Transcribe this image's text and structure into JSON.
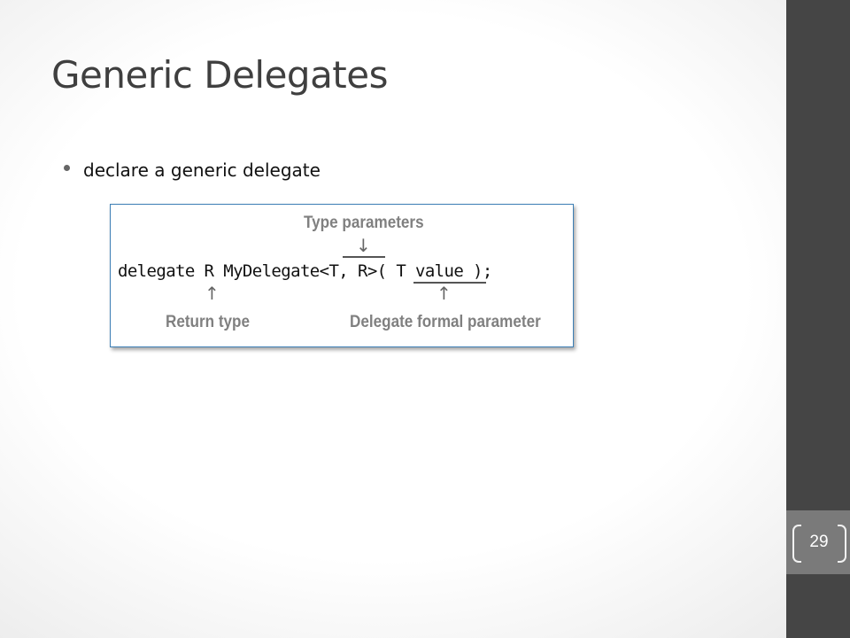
{
  "slide": {
    "title": "Generic Delegates",
    "bullets": [
      {
        "text": "declare a generic delegate"
      }
    ],
    "page_number": "29"
  },
  "figure": {
    "code": "delegate R MyDelegate<T, R>( T value );",
    "labels": {
      "type_parameters": "Type parameters",
      "return_type": "Return type",
      "formal_parameter": "Delegate formal parameter"
    },
    "arrow_down": "↓",
    "arrow_up": "↑"
  },
  "theme": {
    "sidebar_color": "#454545",
    "page_box_color": "#7a7a7a",
    "figure_border_color": "#3d7fb5",
    "title_color": "#3f3f3f"
  }
}
